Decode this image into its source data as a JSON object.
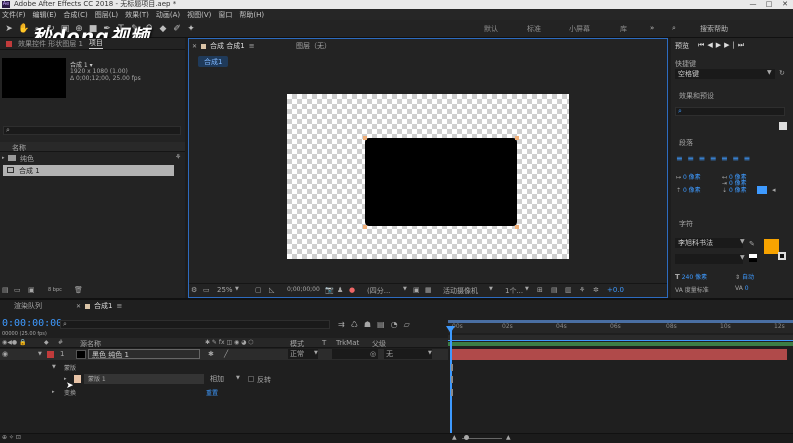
{
  "title_bar": {
    "app_title": "Adobe After Effects CC 2018 - 无标题项目.aep *",
    "min": "—",
    "max": "□",
    "close": "✕"
  },
  "menu": [
    "文件(F)",
    "编辑(E)",
    "合成(C)",
    "图层(L)",
    "效果(T)",
    "动画(A)",
    "视图(V)",
    "窗口",
    "帮助(H)"
  ],
  "workspaces": [
    "默认",
    "标准",
    "小屏幕",
    "库"
  ],
  "search_help": {
    "placeholder": "搜索帮助"
  },
  "watermark": "秒dong视频",
  "project": {
    "tab_label": "项目",
    "effects_controls_tab": "效果控件 形状图层 1",
    "comp_name": "合成 1 ▾",
    "comp_res": "1920 x 1080 (1.00)",
    "comp_dur": "Δ 0;00;12;00, 25.00 fps",
    "name_header": "名称",
    "items": [
      {
        "name": "纯色"
      },
      {
        "name": "合成 1"
      }
    ],
    "bpc": "8 bpc"
  },
  "composition_panel": {
    "tab": "合成 合成1",
    "layer_tab": "图层（无）",
    "sub_tab": "合成1",
    "zoom": "25%",
    "time": "0;00;00;00",
    "quality": "(四分...",
    "camera": "活动摄像机",
    "views": "1个...",
    "exposure": "+0.0"
  },
  "right_panel": {
    "preview_tab": "预览",
    "shortcut_label": "快捷键",
    "shortcut_value": "空格键",
    "effects_tab": "效果和预设",
    "paragraph_tab": "段落",
    "px_values": [
      "0 像素",
      "0 像素",
      "0 像素",
      "0 像素",
      "0 像素"
    ],
    "character_tab": "字符",
    "font_name": "李旭科书法",
    "font_size": "240 像素",
    "leading": "自动",
    "kerning": "度量标准",
    "tracking": "0",
    "px_unit": "像素",
    "va_value": "0"
  },
  "timeline": {
    "render_queue_tab": "渲染队列",
    "comp_tab": "合成1",
    "timecode": "0:00:00:00",
    "fps_note": "00000 (25.00 fps)",
    "col_source": "源名称",
    "col_mode": "模式",
    "col_t": "T",
    "col_trkmat": "TrkMat",
    "col_parent": "父级",
    "layer1_num": "1",
    "layer1_name": "黑色 纯色 1",
    "layer1_mode": "正常",
    "layer1_parent": "无",
    "mask_group": "蒙版",
    "mask1_name": "蒙版 1",
    "mask1_mode": "相加",
    "mask1_invert": "反转",
    "transform_label": "变换",
    "reset_label": "重置",
    "ruler_ticks": [
      "00s",
      "02s",
      "04s",
      "06s",
      "08s",
      "10s",
      "12s"
    ]
  },
  "colors": {
    "accent_blue": "#3e9aff",
    "layer_red": "#b04a4a",
    "char_fill": "#f7a300",
    "canvas_black": "#000000"
  }
}
